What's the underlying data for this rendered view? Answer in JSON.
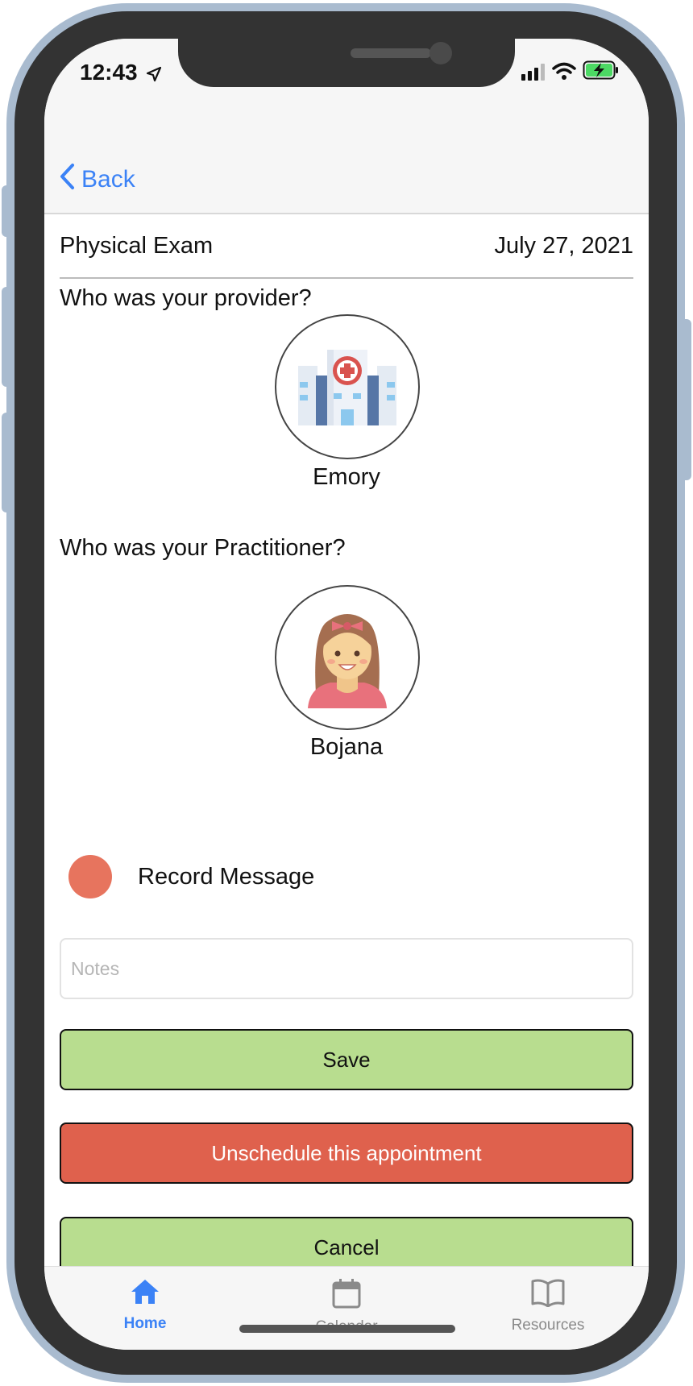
{
  "status_bar": {
    "time": "12:43",
    "location_icon": "location-arrow-icon",
    "signal_icon": "cellular-signal-icon",
    "wifi_icon": "wifi-icon",
    "battery_icon": "battery-charging-icon",
    "battery_color": "#4cd964"
  },
  "nav": {
    "back_label": "Back",
    "back_icon": "chevron-left-icon",
    "accent": "#3b82f6"
  },
  "appointment": {
    "title": "Physical Exam",
    "date": "July 27, 2021"
  },
  "provider": {
    "question": "Who was your provider?",
    "name": "Emory",
    "icon": "hospital-icon"
  },
  "practitioner": {
    "question": "Who was your Practitioner?",
    "name": "Bojana",
    "icon": "woman-avatar-icon"
  },
  "record": {
    "label": "Record Message",
    "color": "#e7745e"
  },
  "notes": {
    "placeholder": "Notes",
    "value": ""
  },
  "buttons": {
    "save_label": "Save",
    "unschedule_label": "Unschedule this appointment",
    "cancel_label": "Cancel",
    "save_color": "#b8dd8f",
    "unschedule_color": "#df614d"
  },
  "tabs": [
    {
      "label": "Home",
      "icon": "home-icon",
      "active": true
    },
    {
      "label": "Calendar",
      "icon": "calendar-icon",
      "active": false
    },
    {
      "label": "Resources",
      "icon": "book-icon",
      "active": false
    }
  ]
}
